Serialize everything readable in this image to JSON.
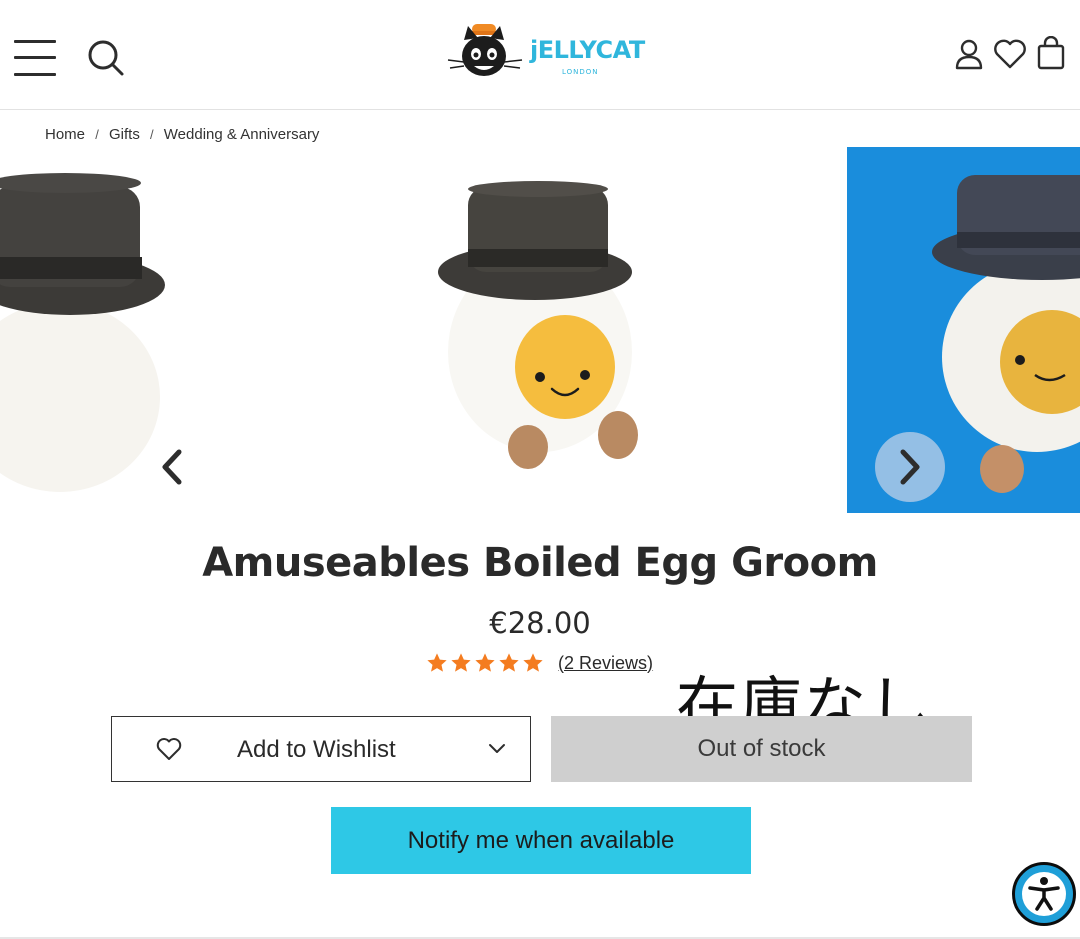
{
  "header": {
    "logo_text": "jELLYCAT",
    "logo_sub": "LONDON",
    "icons": [
      "menu-icon",
      "search-icon",
      "account-icon",
      "heart-icon",
      "bag-icon"
    ]
  },
  "breadcrumb": {
    "items": [
      "Home",
      "Gifts",
      "Wedding & Anniversary"
    ],
    "separator": "/"
  },
  "carousel": {
    "prev_icon": "chevron-left-icon",
    "next_icon": "chevron-right-icon"
  },
  "product": {
    "title": "Amuseables Boiled Egg Groom",
    "price": "€28.00",
    "rating": 5,
    "rating_max": 5,
    "reviews_label": "(2 Reviews)",
    "note": "在庫なし"
  },
  "actions": {
    "wishlist_label": "Add to Wishlist",
    "out_of_stock_label": "Out of stock",
    "notify_label": "Notify me when available"
  },
  "colors": {
    "brand": "#2fb6dc",
    "notify_button": "#2ec8e6",
    "out_of_stock_bg": "#cfcfcf",
    "star": "#f47c20",
    "accessibility": "#1f9fd8"
  }
}
